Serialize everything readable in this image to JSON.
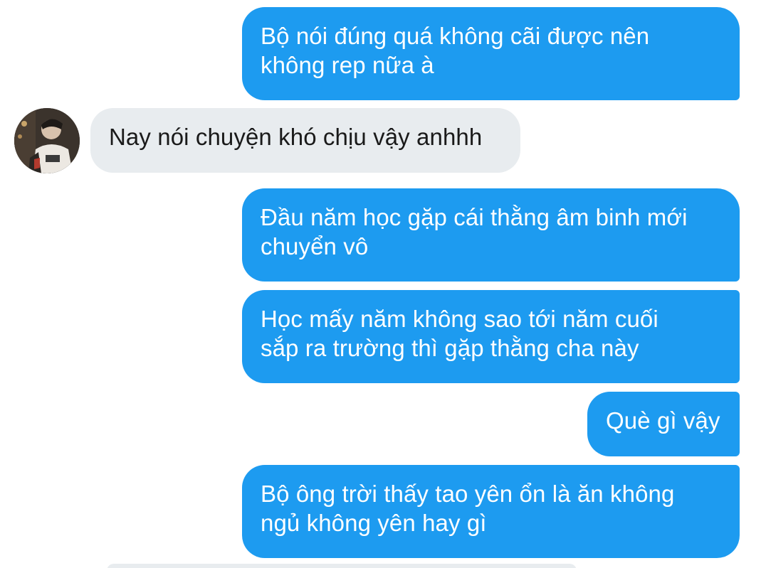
{
  "conversation": {
    "messages": [
      {
        "sender": "me",
        "text": "Bộ nói đúng quá không cãi được nên\nkhông rep nữa à"
      },
      {
        "sender": "other",
        "text": "Nay nói chuyện khó chịu vậy anhhh"
      },
      {
        "sender": "me",
        "text": "Đầu năm học gặp cái thằng âm binh mới\nchuyển vô"
      },
      {
        "sender": "me",
        "text": "Học mấy năm không sao tới năm cuối\nsắp ra trường thì gặp thằng cha này"
      },
      {
        "sender": "me",
        "text": "Què gì vậy"
      },
      {
        "sender": "me",
        "text": "Bộ ông trời thấy tao yên ổn là ăn không\nngủ không yên hay gì"
      }
    ]
  },
  "colors": {
    "outgoing_bubble": "#1d9bf0",
    "incoming_bubble": "#e8ecef",
    "outgoing_text": "#ffffff",
    "incoming_text": "#1a1a1a"
  },
  "avatar": {
    "icon": "user-avatar-photo"
  }
}
